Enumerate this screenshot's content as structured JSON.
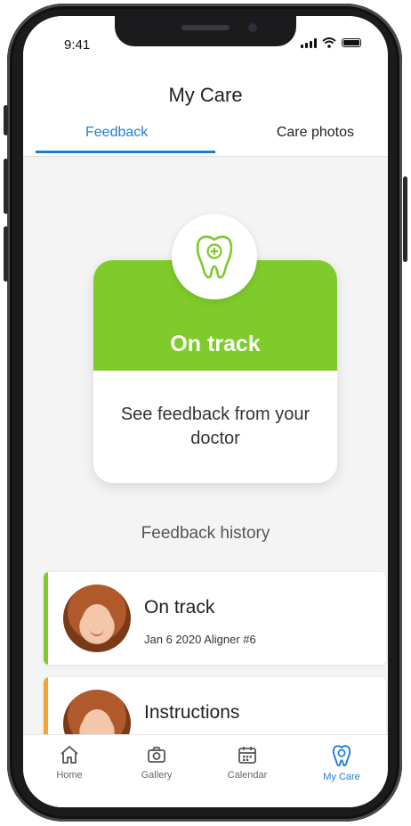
{
  "status_bar": {
    "time": "9:41"
  },
  "header": {
    "title": "My Care",
    "tabs": [
      {
        "label": "Feedback",
        "active": true
      },
      {
        "label": "Care photos",
        "active": false
      }
    ]
  },
  "status_card": {
    "status": "On track",
    "message": "See feedback from your doctor",
    "icon": "tooth-plus-icon",
    "color": "#7ecb2b"
  },
  "history": {
    "title": "Feedback history",
    "items": [
      {
        "title": "On track",
        "subtitle": "Jan 6 2020 Aligner #6",
        "accent_color": "#7ecb2b",
        "avatar": "doctor-avatar"
      },
      {
        "title": "Instructions",
        "subtitle": "",
        "accent_color": "#f0a531",
        "avatar": "doctor-avatar"
      }
    ]
  },
  "tabbar": {
    "items": [
      {
        "label": "Home",
        "icon": "home-icon",
        "active": false
      },
      {
        "label": "Gallery",
        "icon": "camera-icon",
        "active": false
      },
      {
        "label": "Calendar",
        "icon": "calendar-icon",
        "active": false
      },
      {
        "label": "My Care",
        "icon": "tooth-icon",
        "active": true
      }
    ],
    "active_color": "#1f7ed1"
  }
}
